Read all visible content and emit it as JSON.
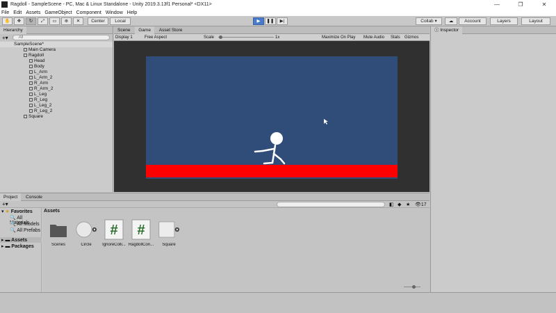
{
  "window": {
    "title": "Ragdoll - SampleScene - PC, Mac & Linux Standalone - Unity 2019.3.13f1 Personal* <DX11>",
    "minimize": "—",
    "maximize": "❐",
    "close": "✕"
  },
  "menu": [
    "File",
    "Edit",
    "Assets",
    "GameObject",
    "Component",
    "Window",
    "Help"
  ],
  "toolbar": {
    "pivot": "Center",
    "space": "Local",
    "collab": "Collab ▾",
    "account": "Account",
    "layers": "Layers",
    "layout": "Layout"
  },
  "hierarchy": {
    "tab": "Hierarchy",
    "search_placeholder": "All",
    "scene": "SampleScene*",
    "items": [
      {
        "label": "Main Camera",
        "depth": 1
      },
      {
        "label": "Ragdoll",
        "depth": 1
      },
      {
        "label": "Head",
        "depth": 2
      },
      {
        "label": "Body",
        "depth": 2
      },
      {
        "label": "L_Arm",
        "depth": 2
      },
      {
        "label": "L_Arm_2",
        "depth": 2
      },
      {
        "label": "R_Arm",
        "depth": 2
      },
      {
        "label": "R_Arm_2",
        "depth": 2
      },
      {
        "label": "L_Leg",
        "depth": 2
      },
      {
        "label": "R_Leg",
        "depth": 2
      },
      {
        "label": "L_Leg_2",
        "depth": 2
      },
      {
        "label": "R_Leg_2",
        "depth": 2
      },
      {
        "label": "Square",
        "depth": 1
      }
    ]
  },
  "game": {
    "tabs": [
      "Scene",
      "Game",
      "Asset Store"
    ],
    "display": "Display 1",
    "aspect": "Free Aspect",
    "scale_label": "Scale",
    "scale_value": "1x",
    "maximize": "Maximize On Play",
    "mute": "Mute Audio",
    "stats": "Stats",
    "gizmos": "Gizmos",
    "sky_color": "#2f4d78",
    "ground_color": "#ff0000"
  },
  "inspector": {
    "tab": "Inspector"
  },
  "project": {
    "tabs": [
      "Project",
      "Console"
    ],
    "favorites": "Favorites",
    "fav_items": [
      "All Materials",
      "All Models",
      "All Prefabs"
    ],
    "assets_folder": "Assets",
    "packages_folder": "Packages",
    "breadcrumb": "Assets",
    "count": "17",
    "assets": [
      "Scenes",
      "Circle",
      "IgnoreColli...",
      "RagdollCon...",
      "Square"
    ]
  }
}
